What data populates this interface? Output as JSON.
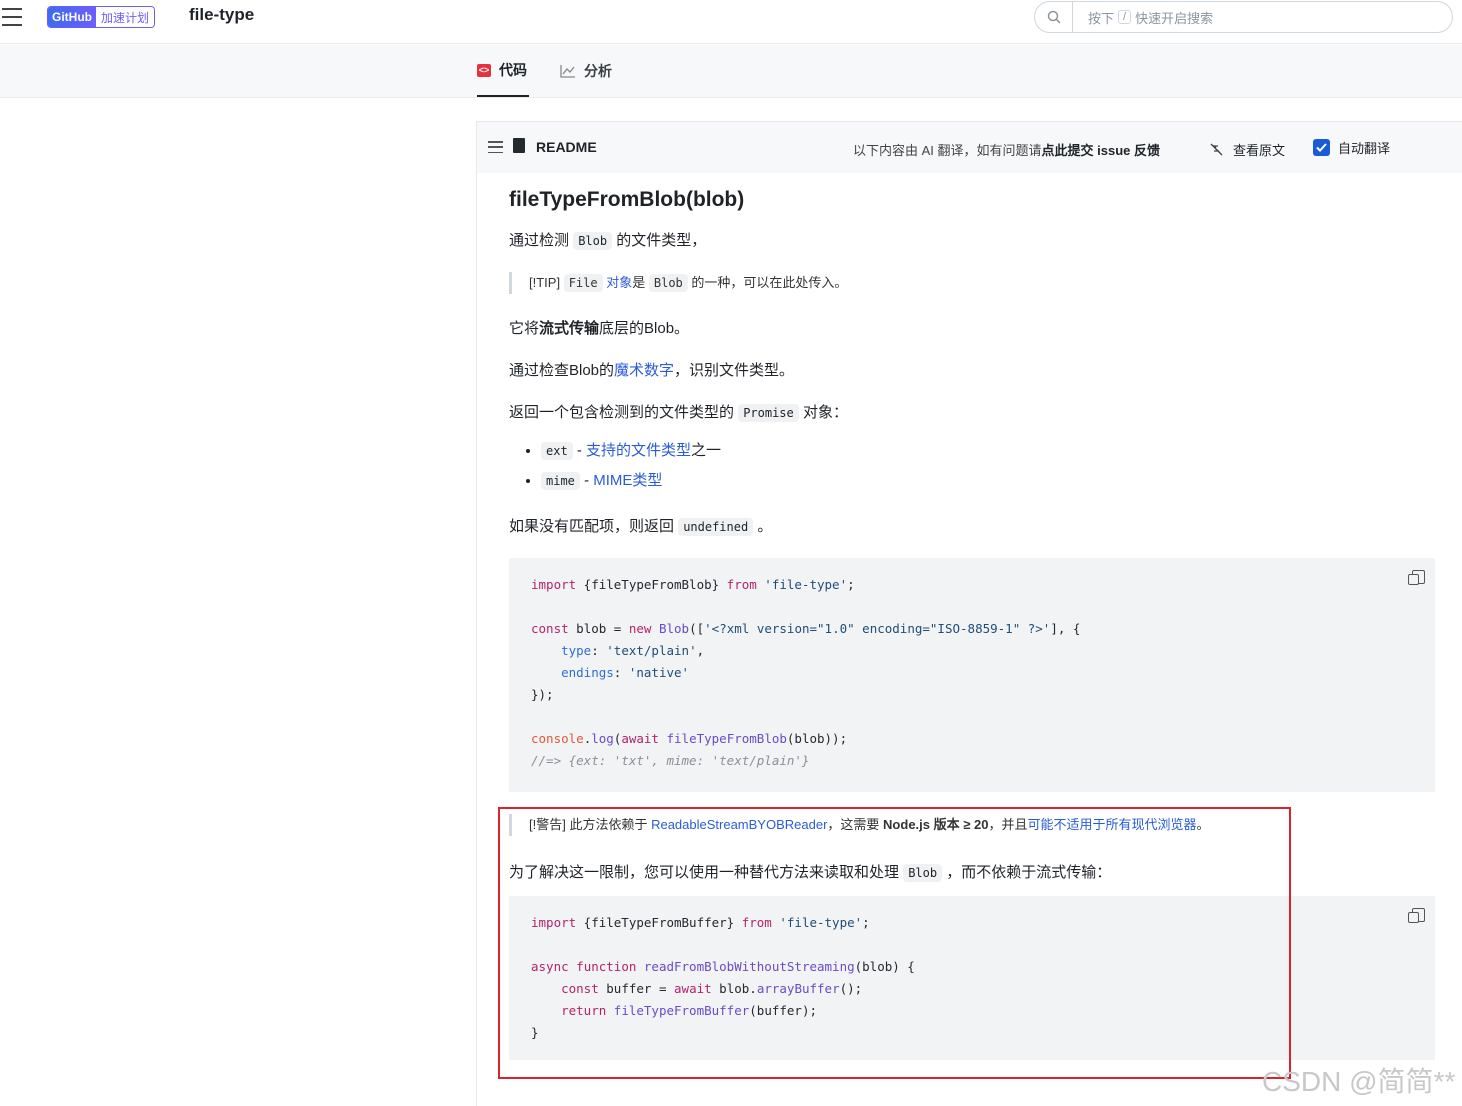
{
  "header": {
    "github_label": "GitHub",
    "plan_label": "加速计划",
    "repo_title": "file-type",
    "search_prefix": "按下",
    "search_key": "/",
    "search_suffix": "快速开启搜索"
  },
  "tabs": [
    {
      "label": "代码",
      "active": true
    },
    {
      "label": "分析",
      "active": false
    }
  ],
  "readme": {
    "label": "README",
    "ai_note_prefix": "以下内容由 AI 翻译，如有问题请",
    "ai_note_bold": "点此提交 issue 反馈",
    "view_original": "查看原文",
    "auto_translate": "自动翻译"
  },
  "content": {
    "heading": "fileTypeFromBlob(blob)",
    "p1_prefix": "通过检测",
    "p1_code": "Blob",
    "p1_suffix": "的文件类型，",
    "tip_prefix": "[!TIP]",
    "tip_code1": "File",
    "tip_link": "对象",
    "tip_mid": "是",
    "tip_code2": "Blob",
    "tip_suffix": "的一种，可以在此处传入。",
    "p2_prefix": "它将",
    "p2_bold": "流式传输",
    "p2_suffix": "底层的Blob。",
    "p3_prefix": "通过检查Blob的",
    "p3_link": "魔术数字",
    "p3_suffix": "，识别文件类型。",
    "p4_prefix": "返回一个包含检测到的文件类型的",
    "p4_code": "Promise",
    "p4_suffix": "对象：",
    "list": [
      {
        "code": "ext",
        "sep": "-",
        "link": "支持的文件类型",
        "suffix": "之一"
      },
      {
        "code": "mime",
        "sep": "-",
        "link": "MIME类型",
        "suffix": ""
      }
    ],
    "p5_prefix": "如果没有匹配项，则返回",
    "p5_code": "undefined",
    "p5_suffix": "。",
    "warn_prefix": "[!警告] 此方法依赖于",
    "warn_link1": "ReadableStreamBYOBReader",
    "warn_mid": "，这需要",
    "warn_bold": "Node.js 版本 ≥ 20",
    "warn_mid2": "，并且",
    "warn_link2": "可能不适用于所有现代浏览器",
    "warn_suffix": "。",
    "p6_prefix": "为了解决这一限制，您可以使用一种替代方法来读取和处理",
    "p6_code": "Blob",
    "p6_suffix": "，而不依赖于流式传输："
  },
  "code1": {
    "l1_kw": "import",
    "l1_a": " {fileTypeFromBlob} ",
    "l1_kw2": "from",
    "l1_str": " 'file-type'",
    "l1_end": ";",
    "l3_kw": "const",
    "l3_a": " blob = ",
    "l3_kw2": "new",
    "l3_fn": " Blob",
    "l3_b": "([",
    "l3_str": "'<?xml version=\"1.0\" encoding=\"ISO-8859-1\" ?>'",
    "l3_end": "], {",
    "l4_prop": "type",
    "l4_a": ": ",
    "l4_str": "'text/plain'",
    "l4_end": ",",
    "l5_prop": "endings",
    "l5_a": ": ",
    "l5_str": "'native'",
    "l6": "});",
    "l8_cons": "console",
    "l8_a": ".",
    "l8_fn": "log",
    "l8_b": "(",
    "l8_kw": "await",
    "l8_fn2": " fileTypeFromBlob",
    "l8_end": "(blob));",
    "l9_cm": "//=> {ext: 'txt', mime: 'text/plain'}"
  },
  "code2": {
    "l1_kw": "import",
    "l1_a": " {fileTypeFromBuffer} ",
    "l1_kw2": "from",
    "l1_str": " 'file-type'",
    "l1_end": ";",
    "l3_kw": "async",
    "l3_kw2": " function",
    "l3_fn": " readFromBlobWithoutStreaming",
    "l3_end": "(blob) {",
    "l4_kw": "const",
    "l4_a": " buffer = ",
    "l4_kw2": "await",
    "l4_b": " blob.",
    "l4_fn": "arrayBuffer",
    "l4_end": "();",
    "l5_kw": "return",
    "l5_fn": " fileTypeFromBuffer",
    "l5_end": "(buffer);",
    "l6": "}"
  },
  "watermark": "CSDN @简简**"
}
